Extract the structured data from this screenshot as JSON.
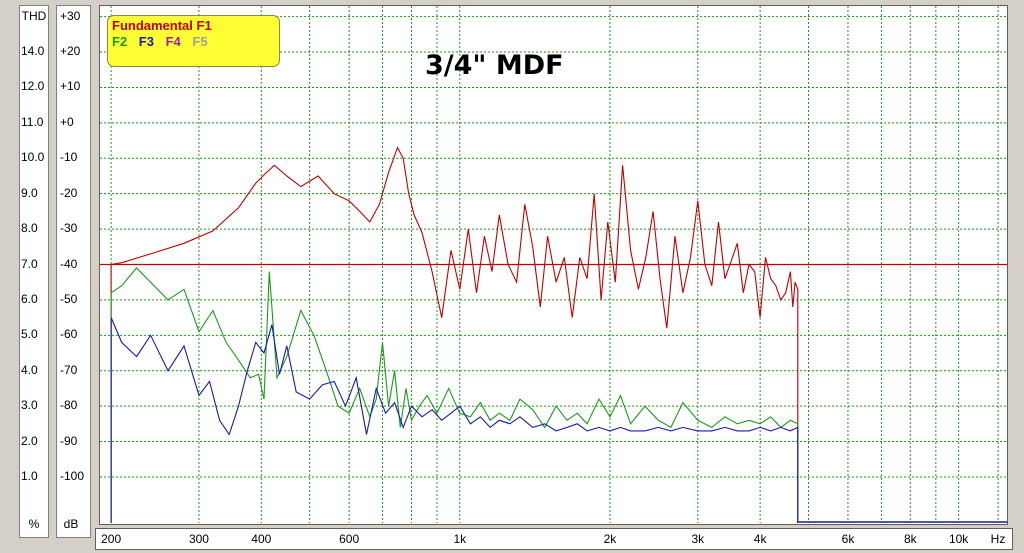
{
  "chart_data": {
    "type": "line",
    "title": "3/4\" MDF",
    "x_scale": "log",
    "xlim": [
      190,
      12500
    ],
    "x_unit": "Hz",
    "x_ticks": [
      {
        "value": 200,
        "label": "200"
      },
      {
        "value": 300,
        "label": "300"
      },
      {
        "value": 400,
        "label": "400"
      },
      {
        "value": 600,
        "label": "600"
      },
      {
        "value": 1000,
        "label": "1k"
      },
      {
        "value": 2000,
        "label": "2k"
      },
      {
        "value": 3000,
        "label": "3k"
      },
      {
        "value": 4000,
        "label": "4k"
      },
      {
        "value": 6000,
        "label": "6k"
      },
      {
        "value": 8000,
        "label": "8k"
      },
      {
        "value": 10000,
        "label": "10k"
      }
    ],
    "x_grid_minor": [
      500,
      700,
      800,
      900,
      5000,
      7000,
      9000,
      12000
    ],
    "db_axis": {
      "unit": "dB",
      "ylim": [
        -113,
        33
      ],
      "ticks": [
        "+30",
        "+20",
        "+10",
        "+0",
        "-10",
        "-20",
        "-30",
        "-40",
        "-50",
        "-60",
        "-70",
        "-80",
        "-90",
        "-100"
      ],
      "tick_values": [
        30,
        20,
        10,
        0,
        -10,
        -20,
        -30,
        -40,
        -50,
        -60,
        -70,
        -80,
        -90,
        -100
      ]
    },
    "thd_axis": {
      "unit": "%",
      "header": "THD",
      "ticks": [
        "14.0",
        "12.0",
        "11.0",
        "10.0",
        "9.0",
        "8.0",
        "7.0",
        "6.0",
        "5.0",
        "4.0",
        "3.0",
        "2.0",
        "1.0"
      ],
      "tick_values": [
        14,
        12,
        11,
        10,
        9,
        8,
        7,
        6,
        5,
        4,
        3,
        2,
        1
      ]
    },
    "reference_line_db": -40,
    "grid": true,
    "legend_position": "top-left",
    "legend": {
      "title": "Fundamental F1",
      "items": [
        {
          "label": "F2",
          "color": "#1a9a1a"
        },
        {
          "label": "F3",
          "color": "#1a1aa8"
        },
        {
          "label": "F4",
          "color": "#a020a0"
        },
        {
          "label": "F5",
          "color": "#a0a0a0"
        }
      ]
    },
    "series": [
      {
        "name": "Fundamental F1",
        "color": "#c00000",
        "x": [
          200,
          210,
          240,
          280,
          320,
          360,
          390,
          410,
          425,
          450,
          480,
          520,
          560,
          600,
          630,
          660,
          690,
          720,
          750,
          770,
          790,
          810,
          840,
          880,
          920,
          960,
          1000,
          1040,
          1080,
          1120,
          1160,
          1200,
          1250,
          1300,
          1350,
          1400,
          1450,
          1500,
          1560,
          1620,
          1680,
          1740,
          1800,
          1860,
          1920,
          1980,
          2050,
          2120,
          2200,
          2280,
          2360,
          2440,
          2520,
          2600,
          2700,
          2800,
          2900,
          3000,
          3100,
          3200,
          3300,
          3400,
          3500,
          3600,
          3700,
          3800,
          3900,
          4000,
          4100,
          4200,
          4300,
          4400,
          4500,
          4600,
          4650,
          4700,
          4760
        ],
        "y": [
          -40,
          -39.5,
          -37,
          -34,
          -30.5,
          -24,
          -17,
          -14,
          -12,
          -15,
          -18,
          -15,
          -20,
          -22,
          -25,
          -28,
          -23,
          -14,
          -7,
          -10,
          -20,
          -26,
          -31,
          -42,
          -55,
          -36,
          -47,
          -30,
          -48,
          -32,
          -42,
          -26,
          -40,
          -45,
          -23,
          -35,
          -52,
          -32,
          -45,
          -38,
          -55,
          -38,
          -44,
          -20,
          -50,
          -28,
          -45,
          -12,
          -36,
          -47,
          -38,
          -25,
          -44,
          -58,
          -32,
          -48,
          -38,
          -22,
          -40,
          -46,
          -28,
          -44,
          -39,
          -34,
          -48,
          -40,
          -42,
          -55,
          -38,
          -44,
          -46,
          -50,
          -48,
          -42,
          -52,
          -45,
          -47
        ]
      },
      {
        "name": "F2",
        "color": "#1a9a1a",
        "x": [
          200,
          210,
          225,
          240,
          260,
          280,
          300,
          320,
          340,
          360,
          380,
          395,
          405,
          415,
          430,
          450,
          480,
          510,
          540,
          570,
          600,
          630,
          660,
          680,
          700,
          720,
          740,
          760,
          780,
          800,
          830,
          860,
          900,
          950,
          1000,
          1050,
          1100,
          1150,
          1200,
          1260,
          1320,
          1400,
          1480,
          1560,
          1640,
          1720,
          1800,
          1900,
          2000,
          2100,
          2200,
          2350,
          2500,
          2650,
          2800,
          3000,
          3200,
          3400,
          3600,
          3800,
          4000,
          4200,
          4400,
          4600,
          4760
        ],
        "y": [
          -48,
          -46,
          -41,
          -45,
          -50,
          -47,
          -59,
          -53,
          -62,
          -67,
          -72,
          -71,
          -78,
          -42,
          -72,
          -66,
          -53,
          -60,
          -70,
          -80,
          -82,
          -75,
          -83,
          -78,
          -62,
          -80,
          -70,
          -86,
          -75,
          -84,
          -80,
          -77,
          -82,
          -75,
          -82,
          -83,
          -79,
          -84,
          -82,
          -84,
          -78,
          -81,
          -86,
          -80,
          -84,
          -82,
          -85,
          -78,
          -83,
          -77,
          -85,
          -80,
          -84,
          -86,
          -79,
          -84,
          -86,
          -83,
          -85,
          -84,
          -85,
          -83,
          -86,
          -84,
          -85
        ]
      },
      {
        "name": "F3",
        "color": "#1a1aa8",
        "x": [
          200,
          210,
          225,
          240,
          260,
          280,
          300,
          315,
          330,
          345,
          360,
          375,
          390,
          405,
          420,
          435,
          450,
          470,
          500,
          530,
          560,
          590,
          620,
          650,
          680,
          710,
          740,
          770,
          800,
          840,
          880,
          920,
          960,
          1000,
          1050,
          1100,
          1150,
          1200,
          1260,
          1320,
          1400,
          1480,
          1560,
          1640,
          1720,
          1800,
          1900,
          2000,
          2100,
          2200,
          2350,
          2500,
          2650,
          2800,
          3000,
          3200,
          3400,
          3600,
          3800,
          4000,
          4200,
          4400,
          4600,
          4760
        ],
        "y": [
          -55,
          -62,
          -66,
          -60,
          -70,
          -63,
          -77,
          -73,
          -84,
          -88,
          -80,
          -70,
          -62,
          -65,
          -57,
          -71,
          -63,
          -76,
          -78,
          -74,
          -73,
          -80,
          -72,
          -88,
          -75,
          -82,
          -79,
          -86,
          -80,
          -83,
          -81,
          -84,
          -82,
          -80,
          -85,
          -83,
          -86,
          -84,
          -85,
          -83,
          -86,
          -85,
          -87,
          -86,
          -85,
          -87,
          -86,
          -87,
          -86,
          -87,
          -87,
          -86,
          -87,
          -86,
          -87,
          -87,
          -86,
          -87,
          -87,
          -86,
          -87,
          -86,
          -87,
          -86
        ]
      }
    ],
    "cutoff_x": 4760
  }
}
